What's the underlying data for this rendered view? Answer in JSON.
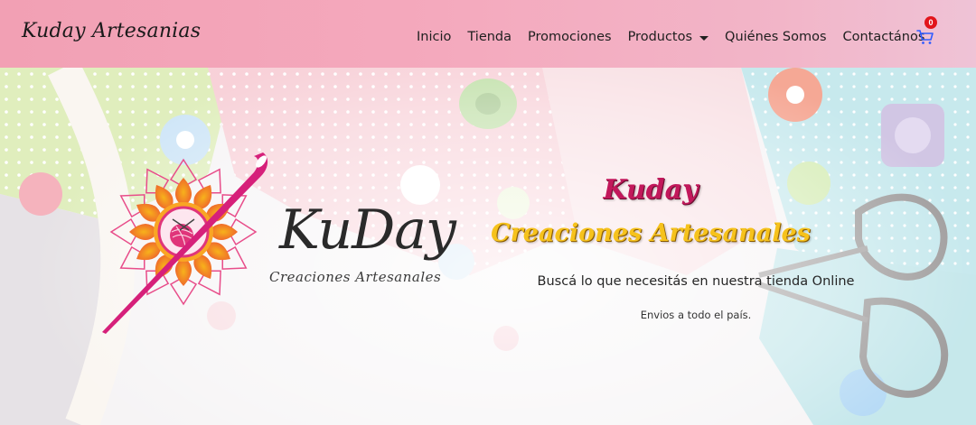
{
  "header": {
    "brand": "Kuday Artesanias",
    "nav": {
      "inicio": "Inicio",
      "tienda": "Tienda",
      "promociones": "Promociones",
      "productos": "Productos",
      "quienes": "Quiénes Somos",
      "contacto": "Contactános"
    },
    "cart_count": "0",
    "cart_icon": "shopping-cart-icon",
    "colors": {
      "gradient_start": "#f2a0b4",
      "gradient_end": "#efc3d6",
      "cart_blue": "#2f5bff",
      "badge_red": "#e2151b"
    }
  },
  "hero": {
    "logo": {
      "name": "KuDay",
      "tagline": "Creaciones Artesanales"
    },
    "title": "Kuday",
    "subtitle": "Creaciones Artesanales",
    "lead": "Buscá lo que necesitás en nuestra tienda Online",
    "small": "Envios a todo el país.",
    "colors": {
      "title": "#c2185b",
      "subtitle": "#f6c21c"
    }
  }
}
